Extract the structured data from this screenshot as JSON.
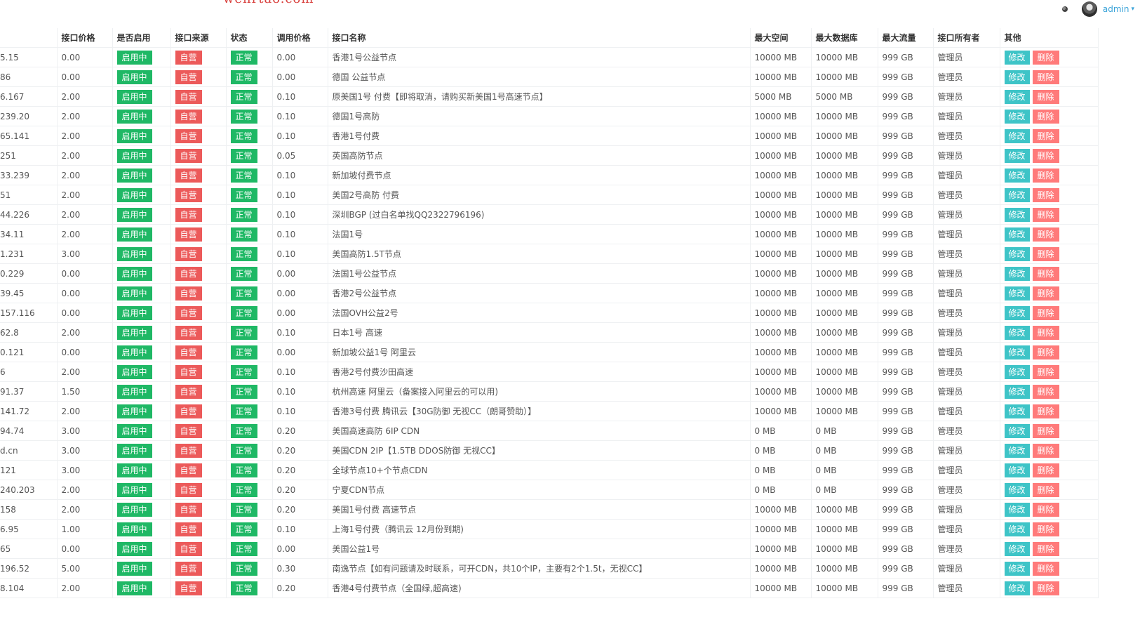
{
  "watermark": "wenrtao.com",
  "user": {
    "name": "admin",
    "menu_icon": "caret-down-icon"
  },
  "colors": {
    "enabled": "#1fb865",
    "source": "#ec5a5a",
    "edit": "#3ec4c7",
    "delete": "#ff7a7a",
    "link": "#3aa3d8"
  },
  "columns": [
    "",
    "接口价格",
    "是否启用",
    "接口来源",
    "状态",
    "调用价格",
    "接口名称",
    "最大空间",
    "最大数据库",
    "最大流量",
    "接口所有者",
    "其他"
  ],
  "actions": {
    "edit": "修改",
    "delete": "删除"
  },
  "rows": [
    {
      "ip": "5.15",
      "price": "0.00",
      "enabled": "启用中",
      "source": "自营",
      "status": "正常",
      "call_price": "0.00",
      "name": "香港1号公益节点",
      "space": "10000 MB",
      "db": "10000 MB",
      "traffic": "999 GB",
      "owner": "管理员"
    },
    {
      "ip": "86",
      "price": "0.00",
      "enabled": "启用中",
      "source": "自营",
      "status": "正常",
      "call_price": "0.00",
      "name": "德国 公益节点",
      "space": "10000 MB",
      "db": "10000 MB",
      "traffic": "999 GB",
      "owner": "管理员"
    },
    {
      "ip": "6.167",
      "price": "2.00",
      "enabled": "启用中",
      "source": "自营",
      "status": "正常",
      "call_price": "0.10",
      "name": "原美国1号 付费【即将取消，请购买新美国1号高速节点】",
      "space": "5000 MB",
      "db": "5000 MB",
      "traffic": "999 GB",
      "owner": "管理员"
    },
    {
      "ip": "239.20",
      "price": "2.00",
      "enabled": "启用中",
      "source": "自营",
      "status": "正常",
      "call_price": "0.10",
      "name": "德国1号高防",
      "space": "10000 MB",
      "db": "10000 MB",
      "traffic": "999 GB",
      "owner": "管理员"
    },
    {
      "ip": "65.141",
      "price": "2.00",
      "enabled": "启用中",
      "source": "自营",
      "status": "正常",
      "call_price": "0.10",
      "name": "香港1号付费",
      "space": "10000 MB",
      "db": "10000 MB",
      "traffic": "999 GB",
      "owner": "管理员"
    },
    {
      "ip": "251",
      "price": "2.00",
      "enabled": "启用中",
      "source": "自营",
      "status": "正常",
      "call_price": "0.05",
      "name": "英国高防节点",
      "space": "10000 MB",
      "db": "10000 MB",
      "traffic": "999 GB",
      "owner": "管理员"
    },
    {
      "ip": "33.239",
      "price": "2.00",
      "enabled": "启用中",
      "source": "自营",
      "status": "正常",
      "call_price": "0.10",
      "name": "新加坡付费节点",
      "space": "10000 MB",
      "db": "10000 MB",
      "traffic": "999 GB",
      "owner": "管理员"
    },
    {
      "ip": "51",
      "price": "2.00",
      "enabled": "启用中",
      "source": "自营",
      "status": "正常",
      "call_price": "0.10",
      "name": "美国2号高防 付费",
      "space": "10000 MB",
      "db": "10000 MB",
      "traffic": "999 GB",
      "owner": "管理员"
    },
    {
      "ip": "44.226",
      "price": "2.00",
      "enabled": "启用中",
      "source": "自营",
      "status": "正常",
      "call_price": "0.10",
      "name": "深圳BGP (过白名单找QQ2322796196)",
      "space": "10000 MB",
      "db": "10000 MB",
      "traffic": "999 GB",
      "owner": "管理员"
    },
    {
      "ip": "34.11",
      "price": "2.00",
      "enabled": "启用中",
      "source": "自营",
      "status": "正常",
      "call_price": "0.10",
      "name": "法国1号",
      "space": "10000 MB",
      "db": "10000 MB",
      "traffic": "999 GB",
      "owner": "管理员"
    },
    {
      "ip": "1.231",
      "price": "3.00",
      "enabled": "启用中",
      "source": "自营",
      "status": "正常",
      "call_price": "0.10",
      "name": "美国高防1.5T节点",
      "space": "10000 MB",
      "db": "10000 MB",
      "traffic": "999 GB",
      "owner": "管理员"
    },
    {
      "ip": "0.229",
      "price": "0.00",
      "enabled": "启用中",
      "source": "自营",
      "status": "正常",
      "call_price": "0.00",
      "name": "法国1号公益节点",
      "space": "10000 MB",
      "db": "10000 MB",
      "traffic": "999 GB",
      "owner": "管理员"
    },
    {
      "ip": "39.45",
      "price": "0.00",
      "enabled": "启用中",
      "source": "自营",
      "status": "正常",
      "call_price": "0.00",
      "name": "香港2号公益节点",
      "space": "10000 MB",
      "db": "10000 MB",
      "traffic": "999 GB",
      "owner": "管理员"
    },
    {
      "ip": "157.116",
      "price": "0.00",
      "enabled": "启用中",
      "source": "自营",
      "status": "正常",
      "call_price": "0.00",
      "name": "法国OVH公益2号",
      "space": "10000 MB",
      "db": "10000 MB",
      "traffic": "999 GB",
      "owner": "管理员"
    },
    {
      "ip": "62.8",
      "price": "2.00",
      "enabled": "启用中",
      "source": "自营",
      "status": "正常",
      "call_price": "0.10",
      "name": "日本1号 高速",
      "space": "10000 MB",
      "db": "10000 MB",
      "traffic": "999 GB",
      "owner": "管理员"
    },
    {
      "ip": "0.121",
      "price": "0.00",
      "enabled": "启用中",
      "source": "自营",
      "status": "正常",
      "call_price": "0.00",
      "name": "新加坡公益1号 阿里云",
      "space": "10000 MB",
      "db": "10000 MB",
      "traffic": "999 GB",
      "owner": "管理员"
    },
    {
      "ip": "6",
      "price": "2.00",
      "enabled": "启用中",
      "source": "自营",
      "status": "正常",
      "call_price": "0.10",
      "name": "香港2号付费沙田高速",
      "space": "10000 MB",
      "db": "10000 MB",
      "traffic": "999 GB",
      "owner": "管理员"
    },
    {
      "ip": "91.37",
      "price": "1.50",
      "enabled": "启用中",
      "source": "自营",
      "status": "正常",
      "call_price": "0.10",
      "name": "杭州高速 阿里云（备案接入阿里云的可以用)",
      "space": "10000 MB",
      "db": "10000 MB",
      "traffic": "999 GB",
      "owner": "管理员"
    },
    {
      "ip": "141.72",
      "price": "2.00",
      "enabled": "启用中",
      "source": "自营",
      "status": "正常",
      "call_price": "0.10",
      "name": "香港3号付费 腾讯云【30G防御 无视CC（朗哥赞助）】",
      "space": "10000 MB",
      "db": "10000 MB",
      "traffic": "999 GB",
      "owner": "管理员"
    },
    {
      "ip": "94.74",
      "price": "3.00",
      "enabled": "启用中",
      "source": "自营",
      "status": "正常",
      "call_price": "0.20",
      "name": "美国高速高防 6IP CDN",
      "space": "0 MB",
      "db": "0 MB",
      "traffic": "999 GB",
      "owner": "管理员"
    },
    {
      "ip": "d.cn",
      "price": "3.00",
      "enabled": "启用中",
      "source": "自营",
      "status": "正常",
      "call_price": "0.20",
      "name": "美国CDN 2IP【1.5TB DDOS防御 无视CC】",
      "space": "0 MB",
      "db": "0 MB",
      "traffic": "999 GB",
      "owner": "管理员"
    },
    {
      "ip": "121",
      "price": "3.00",
      "enabled": "启用中",
      "source": "自营",
      "status": "正常",
      "call_price": "0.20",
      "name": "全球节点10+个节点CDN",
      "space": "0 MB",
      "db": "0 MB",
      "traffic": "999 GB",
      "owner": "管理员"
    },
    {
      "ip": "240.203",
      "price": "2.00",
      "enabled": "启用中",
      "source": "自营",
      "status": "正常",
      "call_price": "0.20",
      "name": "宁夏CDN节点",
      "space": "0 MB",
      "db": "0 MB",
      "traffic": "999 GB",
      "owner": "管理员"
    },
    {
      "ip": "158",
      "price": "2.00",
      "enabled": "启用中",
      "source": "自营",
      "status": "正常",
      "call_price": "0.20",
      "name": "美国1号付费 高速节点",
      "space": "10000 MB",
      "db": "10000 MB",
      "traffic": "999 GB",
      "owner": "管理员"
    },
    {
      "ip": "6.95",
      "price": "1.00",
      "enabled": "启用中",
      "source": "自营",
      "status": "正常",
      "call_price": "0.10",
      "name": "上海1号付费（腾讯云 12月份到期)",
      "space": "10000 MB",
      "db": "10000 MB",
      "traffic": "999 GB",
      "owner": "管理员"
    },
    {
      "ip": "65",
      "price": "0.00",
      "enabled": "启用中",
      "source": "自营",
      "status": "正常",
      "call_price": "0.00",
      "name": "美国公益1号",
      "space": "10000 MB",
      "db": "10000 MB",
      "traffic": "999 GB",
      "owner": "管理员"
    },
    {
      "ip": "196.52",
      "price": "5.00",
      "enabled": "启用中",
      "source": "自营",
      "status": "正常",
      "call_price": "0.30",
      "name": "南逸节点【如有问题请及时联系，可开CDN，共10个IP，主要有2个1.5t，无视CC】",
      "space": "10000 MB",
      "db": "10000 MB",
      "traffic": "999 GB",
      "owner": "管理员"
    },
    {
      "ip": "8.104",
      "price": "2.00",
      "enabled": "启用中",
      "source": "自营",
      "status": "正常",
      "call_price": "0.20",
      "name": "香港4号付费节点（全国绿,超高速)",
      "space": "10000 MB",
      "db": "10000 MB",
      "traffic": "999 GB",
      "owner": "管理员"
    }
  ]
}
